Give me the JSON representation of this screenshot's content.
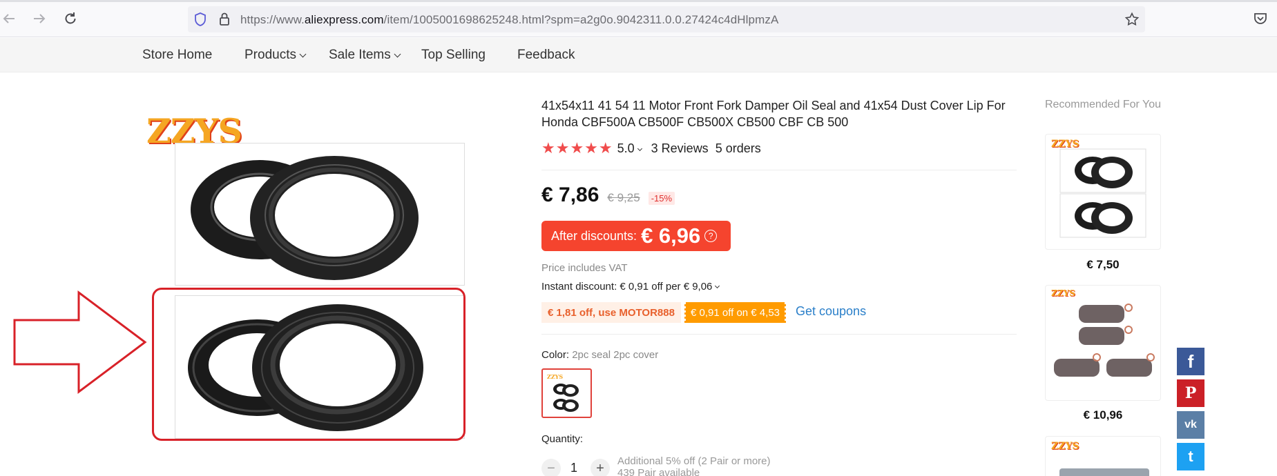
{
  "browser": {
    "url_prefix": "https://www.",
    "url_domain": "aliexpress.com",
    "url_path": "/item/1005001698625248.html?spm=a2g0o.9042311.0.0.27424c4dHlpmzA"
  },
  "store_nav": {
    "items": [
      {
        "label": "Store Home",
        "dropdown": false
      },
      {
        "label": "Products",
        "dropdown": true
      },
      {
        "label": "Sale Items",
        "dropdown": true
      },
      {
        "label": "Top Selling",
        "dropdown": false
      },
      {
        "label": "Feedback",
        "dropdown": false
      }
    ]
  },
  "gallery": {
    "brand": "ZZYS"
  },
  "product": {
    "title": "41x54x11 41 54 11 Motor Front Fork Damper Oil Seal and 41x54 Dust Cover Lip For Honda CBF500A CB500F CB500X CB500 CBF CB 500",
    "stars": "★★★★★",
    "rating": "5.0",
    "reviews": "3 Reviews",
    "orders": "5 orders",
    "price": "€ 7,86",
    "old_price": "€ 9,25",
    "discount": "-15%",
    "after_label": "After discounts:",
    "after_price": "€ 6,96",
    "help_icon": "?",
    "vat": "Price includes VAT",
    "instant_discount": "Instant discount: € 0,91 off per € 9,06",
    "coupon_1": "€ 1,81 off, use MOTOR888",
    "coupon_2": "€ 0,91 off on € 4,53",
    "get_coupons": "Get coupons",
    "color_label": "Color:",
    "color_value": "2pc seal 2pc cover",
    "quantity_label": "Quantity:",
    "quantity": "1",
    "minus": "−",
    "plus": "+",
    "additional": "Additional 5% off (2 Pair or more)",
    "available": "439 Pair available"
  },
  "recommended": {
    "title": "Recommended For You",
    "brand": "ZZYS",
    "items": [
      {
        "price": "€ 7,50"
      },
      {
        "price": "€ 10,96"
      }
    ]
  },
  "social": {
    "facebook": "f",
    "pinterest": "P",
    "vk": "vk",
    "twitter": "t"
  },
  "colors": {
    "accent": "#f5442e",
    "star": "#f04c4c",
    "link": "#2a7fc9",
    "annotation": "#d82128"
  }
}
